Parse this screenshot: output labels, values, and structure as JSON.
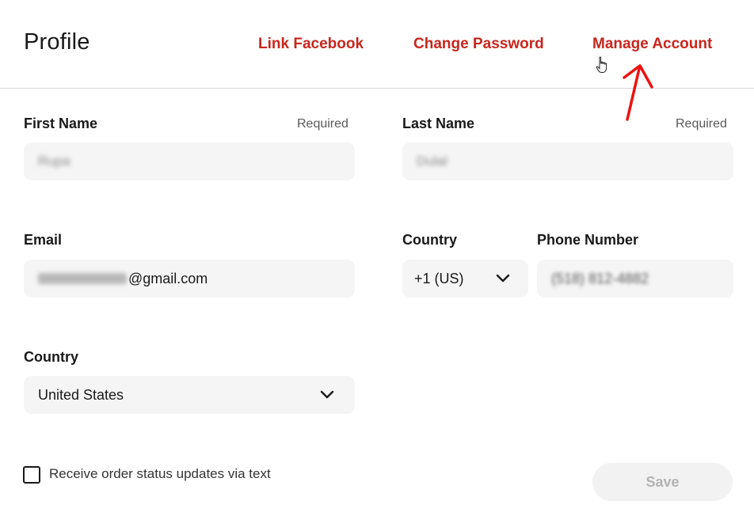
{
  "header": {
    "title": "Profile",
    "links": {
      "link_facebook": "Link Facebook",
      "change_password": "Change Password",
      "manage_account": "Manage Account"
    }
  },
  "form": {
    "first_name": {
      "label": "First Name",
      "required": "Required",
      "value": "Rupa"
    },
    "last_name": {
      "label": "Last Name",
      "required": "Required",
      "value": "Dulal"
    },
    "email": {
      "label": "Email",
      "value_suffix": "@gmail.com"
    },
    "phone_country": {
      "label": "Country",
      "value": "+1 (US)"
    },
    "phone_number": {
      "label": "Phone Number",
      "value": "(518) 812-4882"
    },
    "country": {
      "label": "Country",
      "value": "United States"
    },
    "sms_opt_in": {
      "label": "Receive order status updates via text",
      "checked": false
    },
    "save_label": "Save"
  },
  "colors": {
    "brand_red": "#c7261d",
    "field_bg": "#f5f5f5",
    "annotation_arrow": "#ee1111"
  },
  "icons": [
    "chevron-down-icon",
    "hand-pointer-icon",
    "annotation-arrow-icon"
  ]
}
